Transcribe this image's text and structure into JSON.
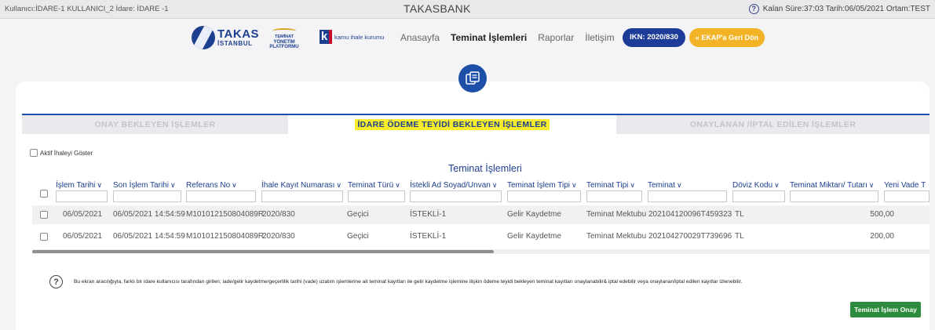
{
  "topbar": {
    "user_info": "Kullanıcı:İDARE-1 KULLANICI_2  İdare: İDARE -1",
    "app_title": "TAKASBANK",
    "session_info": "Kalan Süre:37:03  Tarih:06/05/2021  Ortam:TEST"
  },
  "logos": {
    "takas_line1": "TAKAS",
    "takas_line2": "İSTANBUL",
    "typ_line1": "TEMİNAT",
    "typ_line2": "YÖNETİM PLATFORMU",
    "kik_letter": "k",
    "kik_text": "kamu ihale kurumu"
  },
  "nav": {
    "items": [
      {
        "label": "Anasayfa"
      },
      {
        "label": "Teminat İşlemleri"
      },
      {
        "label": "Raporlar"
      },
      {
        "label": "İletişim"
      }
    ],
    "ikn_button": "IKN: 2020/830",
    "ekap_button": "« EKAP'a Geri Dön"
  },
  "tabs": [
    {
      "label": "ONAY BEKLEYEN İŞLEMLER"
    },
    {
      "label": "İDARE ÖDEME TEYİDİ BEKLEYEN İŞLEMLER"
    },
    {
      "label": "ONAYLANAN /İPTAL EDİLEN İŞLEMLER"
    }
  ],
  "filter_toggle": "Aktif İhaleyi Göster",
  "grid": {
    "title": "Teminat İşlemleri",
    "columns": [
      {
        "label": "İşlem Tarihi",
        "caret": "∨"
      },
      {
        "label": "Son İşlem Tarihi",
        "caret": "∨"
      },
      {
        "label": "Referans No",
        "caret": "∨"
      },
      {
        "label": "İhale Kayıt Numarası",
        "caret": "∨"
      },
      {
        "label": "Teminat Türü",
        "caret": "∨"
      },
      {
        "label": "İstekli Ad Soyad/Unvan",
        "caret": "∨"
      },
      {
        "label": "Teminat İşlem Tipi",
        "caret": "∨"
      },
      {
        "label": "Teminat Tipi",
        "caret": "∨"
      },
      {
        "label": "Teminat",
        "caret": "∨"
      },
      {
        "label": "Döviz Kodu",
        "caret": "∨"
      },
      {
        "label": "Teminat Miktarı/ Tutarı",
        "caret": "∨"
      },
      {
        "label": "Yeni Vade T",
        "caret": ""
      }
    ],
    "rows": [
      {
        "islem_tarihi": "06/05/2021",
        "son_islem_tarihi": "06/05/2021 14:54:59",
        "referans_no": "M101012150804089R",
        "ihale_kayit_no": "2020/830",
        "teminat_turu": "Geçici",
        "istekli": "İSTEKLİ-1",
        "islem_tipi": "Gelir Kaydetme",
        "teminat_tipi": "Teminat Mektubu",
        "teminat": "202104120096T459323",
        "doviz": "TL",
        "tutar": "500,00"
      },
      {
        "islem_tarihi": "06/05/2021",
        "son_islem_tarihi": "06/05/2021 14:54:59",
        "referans_no": "M101012150804089R",
        "ihale_kayit_no": "2020/830",
        "teminat_turu": "Geçici",
        "istekli": "İSTEKLİ-1",
        "islem_tipi": "Gelir Kaydetme",
        "teminat_tipi": "Teminat Mektubu",
        "teminat": "202104270029T739696",
        "doviz": "TL",
        "tutar": "200,00"
      }
    ]
  },
  "info_text": "Bu ekran aracılığıyla, farklı bir idare kullanıcısı tarafından girilen; iade/gelir kaydetme/geçerlilik tarihi (vade) uzatım işlemlerine ait teminat kayıtları ile gelir kaydetme işlemine ilişkin ödeme teyidi bekleyen teminat kayıtları onaylanabilir& iptal edebilir veya onaylanan/iptal edilen kayıtlar izlenebilir.",
  "action_button": "Teminat İşlem Onay",
  "colors": {
    "primary": "#1d3f8f",
    "accent": "#f3b326",
    "success": "#2e8b3e",
    "highlight": "#f6ec2a"
  }
}
